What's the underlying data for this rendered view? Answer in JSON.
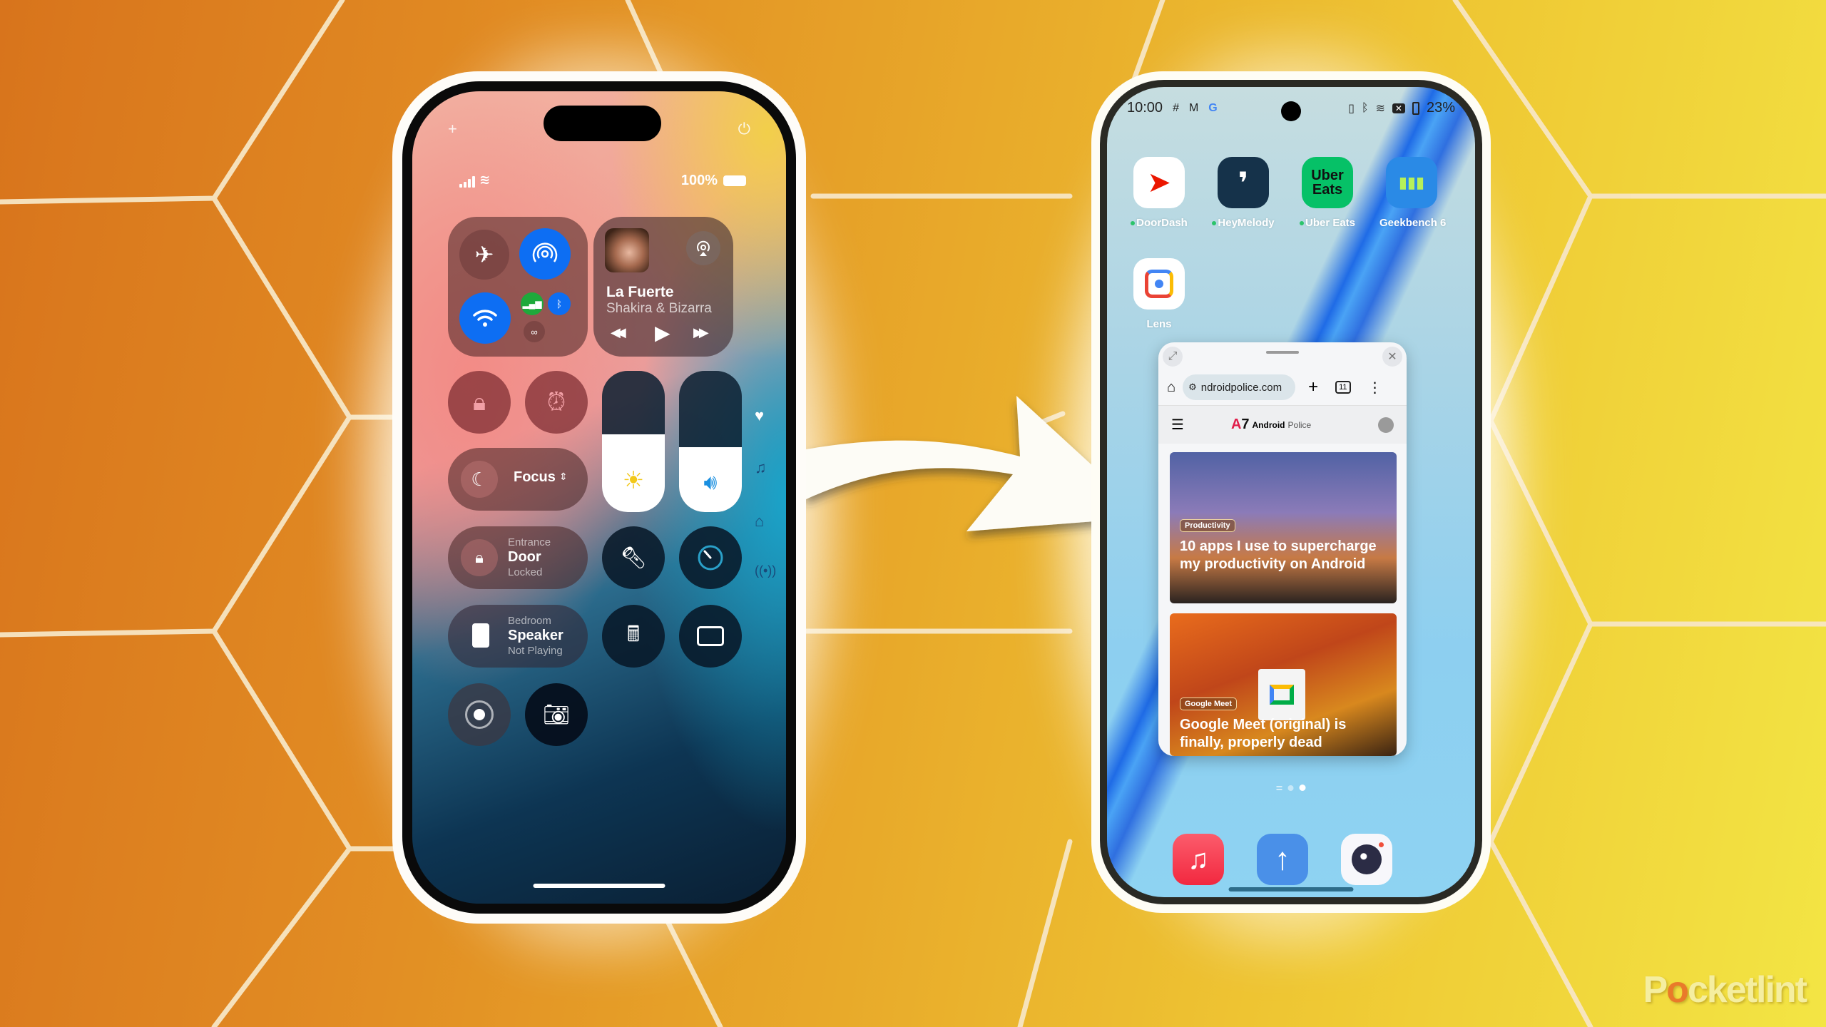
{
  "image": {
    "watermark": {
      "before": "P",
      "accent": "o",
      "after": "cketlint"
    },
    "colors": {
      "background_left": "#d8741c",
      "background_right": "#f3e544",
      "ios_blue": "#0d6ef3",
      "ios_green": "#1ea93b",
      "watermark_accent": "#e97a2a"
    }
  },
  "iphone": {
    "top_icons": {
      "add": "+",
      "power": "⏻"
    },
    "status": {
      "battery_percent": "100%"
    },
    "connectivity": {
      "airplane_mode": "off",
      "airdrop": "on",
      "wifi": "on",
      "cellular": "on",
      "bluetooth": "on",
      "hotspot_link": "off"
    },
    "now_playing": {
      "title": "La Fuerte",
      "artist": "Shakira & Bizarra",
      "controls": {
        "prev": "◀◀",
        "play": "▶",
        "next": "▶▶"
      }
    },
    "toggles": {
      "orientation_lock": "on",
      "alarm": "on",
      "focus_label": "Focus",
      "focus_chevron": "⌃⌄"
    },
    "sliders": {
      "brightness": 0.55,
      "volume": 0.46
    },
    "home_tiles": [
      {
        "room": "Entrance",
        "device": "Door",
        "state": "Locked"
      },
      {
        "room": "Bedroom",
        "device": "Speaker",
        "state": "Not Playing"
      }
    ],
    "rail_icons": [
      "heart",
      "music",
      "home",
      "antenna"
    ]
  },
  "android": {
    "status": {
      "time": "10:00",
      "notif_icons": [
        "slack",
        "gmail",
        "google"
      ],
      "battery_percent": "23%"
    },
    "apps": [
      {
        "name": "DoorDash",
        "new": true,
        "glyph": "D",
        "color": "#ffffff",
        "fg": "#eb1700"
      },
      {
        "name": "HeyMelody",
        "new": true,
        "glyph": "◖",
        "color": "#15324a",
        "fg": "#ffffff"
      },
      {
        "name": "Uber Eats",
        "new": true,
        "glyph": "Uber\nEats",
        "color": "#06c167",
        "fg": "#000000"
      },
      {
        "name": "Geekbench 6",
        "new": false,
        "glyph": "▮▮▮",
        "color": "#2a8ae6",
        "fg": "#b6f05a"
      },
      {
        "name": "Lens",
        "new": false,
        "glyph": "◉",
        "color": "#ffffff",
        "fg": "#4285f4"
      }
    ],
    "popup": {
      "url": "ndroidpolice.com",
      "tab_count": "11",
      "site_name_bold": "Android",
      "site_name_light": "Police",
      "articles": [
        {
          "tag": "Productivity",
          "title": "10 apps I use to supercharge my productivity on Android"
        },
        {
          "tag": "Google Meet",
          "title": "Google Meet (original) is finally, properly dead"
        }
      ]
    },
    "page_indicator": {
      "pages": 2,
      "current": 2
    },
    "dock": [
      {
        "name": "Music",
        "glyph": "♫",
        "color": "#f53d55"
      },
      {
        "name": "Upload",
        "glyph": "↑",
        "color": "#4a90e8"
      },
      {
        "name": "Camera",
        "glyph": "●",
        "color": "#ffffff"
      }
    ]
  }
}
